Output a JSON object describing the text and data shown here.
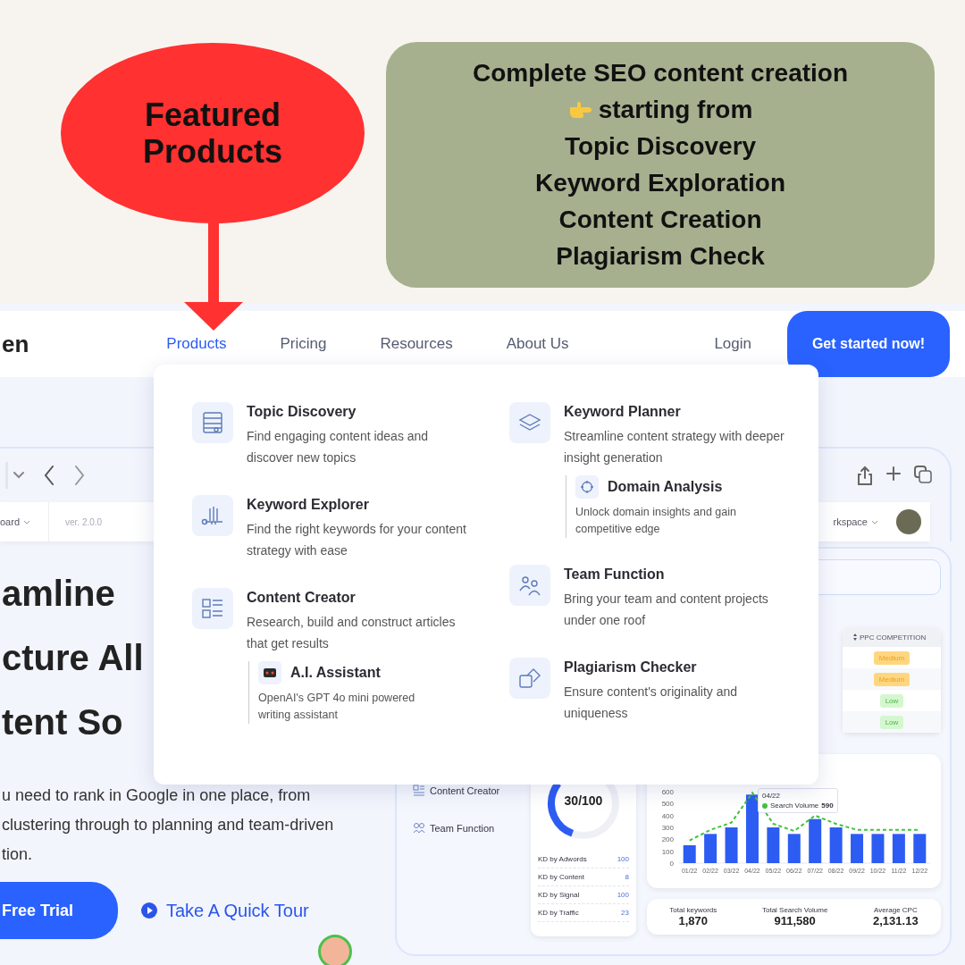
{
  "callout": {
    "title": "Featured Products"
  },
  "note": {
    "heading": "Complete SEO content creation",
    "lead": "starting from",
    "steps": [
      "Topic Discovery",
      "Keyword Exploration",
      "Content Creation",
      "Plagiarism Check"
    ]
  },
  "nav": {
    "logo": "en",
    "links": [
      {
        "label": "Products",
        "selected": true
      },
      {
        "label": "Pricing",
        "selected": false
      },
      {
        "label": "Resources",
        "selected": false
      },
      {
        "label": "About Us",
        "selected": false
      }
    ],
    "login": "Login",
    "cta": "Get started now!"
  },
  "products_menu": {
    "columns": [
      [
        {
          "title": "Topic Discovery",
          "description": "Find engaging content ideas and discover new topics"
        },
        {
          "title": "Keyword Explorer",
          "description": "Find the right keywords for your content strategy with ease"
        },
        {
          "title": "Content Creator",
          "description": "Research, build and construct articles that get results",
          "children": [
            {
              "title": "A.I. Assistant",
              "description": "OpenAI's GPT 4o mini powered writing assistant"
            }
          ]
        }
      ],
      [
        {
          "title": "Keyword Planner",
          "description": "Streamline content strategy with deeper insight generation",
          "children": [
            {
              "title": "Domain Analysis",
              "description": "Unlock domain insights and gain competitive edge"
            }
          ]
        },
        {
          "title": "Team Function",
          "description": "Bring your team and content projects under one roof"
        },
        {
          "title": "Plagiarism Checker",
          "description": "Ensure content's originality and uniqueness"
        }
      ]
    ]
  },
  "hero": {
    "heading_lines": [
      "amline",
      "cture All",
      "tent So"
    ],
    "paragraph_lines": [
      "u need to rank in Google in one place, from",
      "clustering through to planning and team-driven",
      "tion."
    ],
    "primary_button": "Free Trial",
    "tour_link": "Take A Quick Tour"
  },
  "dashboard": {
    "breadcrumb": "oard",
    "version": "ver. 2.0.0",
    "workspace": "rkspace",
    "sidebar": [
      "Content Creator",
      "Team Function"
    ],
    "table": {
      "column": "PPC COMPETITION",
      "rows": [
        {
          "value": "Medium",
          "kind": "medium"
        },
        {
          "value": "Medium",
          "kind": "medium"
        },
        {
          "value": "Low",
          "kind": "low"
        },
        {
          "value": "Low",
          "kind": "low"
        }
      ]
    },
    "gauge": {
      "value": "30/100",
      "level": 0.3
    },
    "kd_rows": [
      {
        "label": "KD by Adwords",
        "value": "100"
      },
      {
        "label": "KD by Content",
        "value": "8"
      },
      {
        "label": "KD by Signal",
        "value": "100"
      },
      {
        "label": "KD by Traffic",
        "value": "23"
      }
    ],
    "chart_data": {
      "type": "bar",
      "categories": [
        "01/22",
        "02/22",
        "03/22",
        "04/22",
        "05/22",
        "06/22",
        "07/22",
        "08/22",
        "09/22",
        "10/22",
        "11/22",
        "12/22"
      ],
      "yticks": [
        0,
        100,
        200,
        300,
        400,
        500,
        600
      ],
      "ylim": [
        0,
        600
      ],
      "series": [
        {
          "color": "#2c5cf2",
          "values": [
            150,
            245,
            300,
            575,
            300,
            245,
            370,
            300,
            245,
            245,
            245,
            245
          ]
        },
        {
          "name": "Search Volume",
          "type": "line",
          "line_style": "dashed",
          "color": "#44c13c",
          "values": [
            190,
            280,
            340,
            590,
            330,
            270,
            400,
            330,
            280,
            280,
            280,
            280
          ]
        }
      ],
      "xlabel": null
    },
    "chart_tooltip": {
      "date": "04/22",
      "value": "590"
    },
    "totals": [
      {
        "label": "Total keywords",
        "value": "1,870"
      },
      {
        "label": "Total Search Volume",
        "value": "911,580"
      },
      {
        "label": "Average CPC",
        "value": "2,131.13"
      }
    ]
  }
}
